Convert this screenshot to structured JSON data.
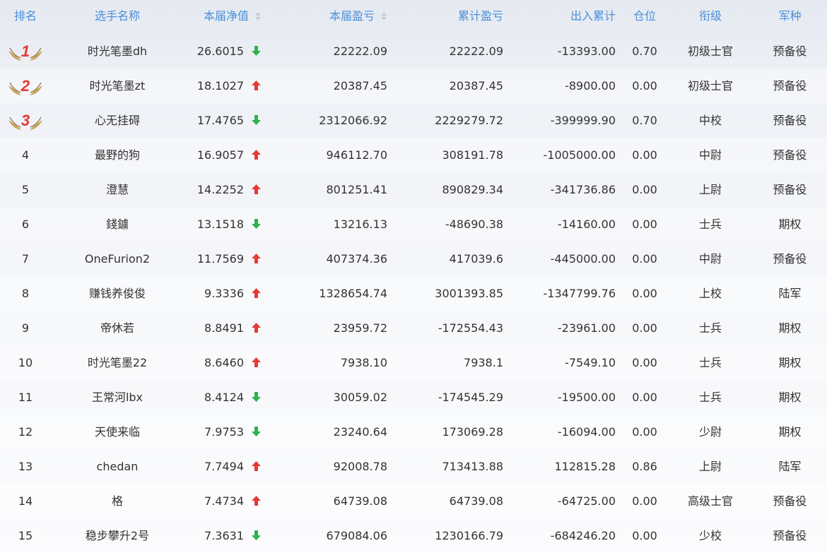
{
  "header": {
    "rank": "排名",
    "name": "选手名称",
    "net_value": "本届净值",
    "profit": "本届盈亏",
    "cumulative": "累计盈亏",
    "flow": "出入累计",
    "position": "仓位",
    "title": "衔级",
    "branch": "军种"
  },
  "colors": {
    "header_text": "#4a90d9",
    "up_arrow": "#e53935",
    "down_arrow": "#2bb24c",
    "medal_number": "#e53935",
    "wing": "#c9a35a"
  },
  "rows": [
    {
      "rank": "1",
      "medal": true,
      "name": "时光笔墨dh",
      "net": "26.6015",
      "trend": "down",
      "profit": "22222.09",
      "cumulative": "22222.09",
      "flow": "-13393.00",
      "position": "0.70",
      "title": "初级士官",
      "branch": "预备役"
    },
    {
      "rank": "2",
      "medal": true,
      "name": "时光笔墨zt",
      "net": "18.1027",
      "trend": "up",
      "profit": "20387.45",
      "cumulative": "20387.45",
      "flow": "-8900.00",
      "position": "0.00",
      "title": "初级士官",
      "branch": "预备役"
    },
    {
      "rank": "3",
      "medal": true,
      "name": "心无挂碍",
      "net": "17.4765",
      "trend": "down",
      "profit": "2312066.92",
      "cumulative": "2229279.72",
      "flow": "-399999.90",
      "position": "0.70",
      "title": "中校",
      "branch": "预备役"
    },
    {
      "rank": "4",
      "medal": false,
      "name": "最野的狗",
      "net": "16.9057",
      "trend": "up",
      "profit": "946112.70",
      "cumulative": "308191.78",
      "flow": "-1005000.00",
      "position": "0.00",
      "title": "中尉",
      "branch": "预备役"
    },
    {
      "rank": "5",
      "medal": false,
      "name": "澄慧",
      "net": "14.2252",
      "trend": "up",
      "profit": "801251.41",
      "cumulative": "890829.34",
      "flow": "-341736.86",
      "position": "0.00",
      "title": "上尉",
      "branch": "预备役"
    },
    {
      "rank": "6",
      "medal": false,
      "name": "錢鐪",
      "net": "13.1518",
      "trend": "down",
      "profit": "13216.13",
      "cumulative": "-48690.38",
      "flow": "-14160.00",
      "position": "0.00",
      "title": "士兵",
      "branch": "期权"
    },
    {
      "rank": "7",
      "medal": false,
      "name": "OneFurion2",
      "net": "11.7569",
      "trend": "up",
      "profit": "407374.36",
      "cumulative": "417039.6",
      "flow": "-445000.00",
      "position": "0.00",
      "title": "中尉",
      "branch": "预备役"
    },
    {
      "rank": "8",
      "medal": false,
      "name": "赚钱养俊俊",
      "net": "9.3336",
      "trend": "up",
      "profit": "1328654.74",
      "cumulative": "3001393.85",
      "flow": "-1347799.76",
      "position": "0.00",
      "title": "上校",
      "branch": "陆军"
    },
    {
      "rank": "9",
      "medal": false,
      "name": "帝休若",
      "net": "8.8491",
      "trend": "up",
      "profit": "23959.72",
      "cumulative": "-172554.43",
      "flow": "-23961.00",
      "position": "0.00",
      "title": "士兵",
      "branch": "期权"
    },
    {
      "rank": "10",
      "medal": false,
      "name": "时光笔墨22",
      "net": "8.6460",
      "trend": "up",
      "profit": "7938.10",
      "cumulative": "7938.1",
      "flow": "-7549.10",
      "position": "0.00",
      "title": "士兵",
      "branch": "期权"
    },
    {
      "rank": "11",
      "medal": false,
      "name": "王常河lbx",
      "net": "8.4124",
      "trend": "down",
      "profit": "30059.02",
      "cumulative": "-174545.29",
      "flow": "-19500.00",
      "position": "0.00",
      "title": "士兵",
      "branch": "期权"
    },
    {
      "rank": "12",
      "medal": false,
      "name": "天使来临",
      "net": "7.9753",
      "trend": "down",
      "profit": "23240.64",
      "cumulative": "173069.28",
      "flow": "-16094.00",
      "position": "0.00",
      "title": "少尉",
      "branch": "期权"
    },
    {
      "rank": "13",
      "medal": false,
      "name": "chedan",
      "net": "7.7494",
      "trend": "up",
      "profit": "92008.78",
      "cumulative": "713413.88",
      "flow": "112815.28",
      "position": "0.86",
      "title": "上尉",
      "branch": "陆军"
    },
    {
      "rank": "14",
      "medal": false,
      "name": "格",
      "net": "7.4734",
      "trend": "up",
      "profit": "64739.08",
      "cumulative": "64739.08",
      "flow": "-64725.00",
      "position": "0.00",
      "title": "高级士官",
      "branch": "预备役"
    },
    {
      "rank": "15",
      "medal": false,
      "name": "稳步攀升2号",
      "net": "7.3631",
      "trend": "down",
      "profit": "679084.06",
      "cumulative": "1230166.79",
      "flow": "-684246.20",
      "position": "0.00",
      "title": "少校",
      "branch": "预备役"
    }
  ]
}
